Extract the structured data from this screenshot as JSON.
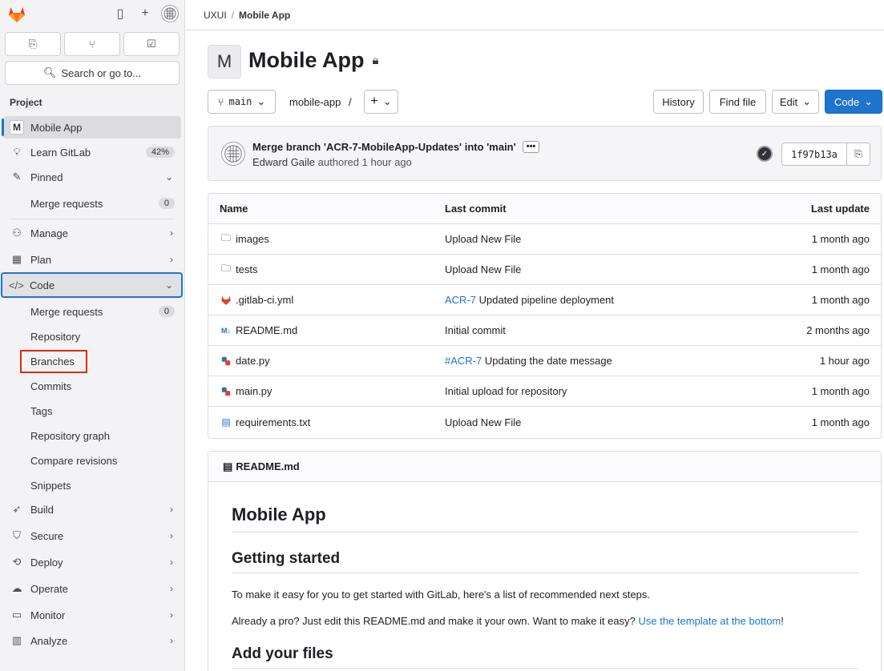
{
  "sidebar": {
    "search_label": "Search or go to...",
    "section_heading": "Project",
    "project_name": "Mobile App",
    "project_initial": "M",
    "learn_gitlab": {
      "label": "Learn GitLab",
      "badge": "42%"
    },
    "pinned": {
      "label": "Pinned"
    },
    "pinned_merge_requests": {
      "label": "Merge requests",
      "badge": "0"
    },
    "manage": "Manage",
    "plan": "Plan",
    "code": "Code",
    "code_items": {
      "merge_requests": {
        "label": "Merge requests",
        "badge": "0"
      },
      "repository": "Repository",
      "branches": "Branches",
      "commits": "Commits",
      "tags": "Tags",
      "repository_graph": "Repository graph",
      "compare_revisions": "Compare revisions",
      "snippets": "Snippets"
    },
    "build": "Build",
    "secure": "Secure",
    "deploy": "Deploy",
    "operate": "Operate",
    "monitor": "Monitor",
    "analyze": "Analyze"
  },
  "breadcrumb": {
    "group": "UXUI",
    "separator": "/",
    "project": "Mobile App"
  },
  "project": {
    "initial": "M",
    "title": "Mobile App"
  },
  "controls": {
    "branch": "main",
    "path": "mobile-app",
    "path_sep": "/",
    "add": "+",
    "history": "History",
    "find_file": "Find file",
    "edit": "Edit",
    "code": "Code"
  },
  "last_commit": {
    "title": "Merge branch 'ACR-7-MobileApp-Updates' into 'main'",
    "author": "Edward Gaile",
    "action": "authored",
    "time": "1 hour ago",
    "sha": "1f97b13a"
  },
  "file_table": {
    "headers": {
      "name": "Name",
      "last_commit": "Last commit",
      "last_update": "Last update"
    },
    "rows": [
      {
        "name": "images",
        "icon": "folder-icon",
        "commit_link": "",
        "commit": "Upload New File",
        "date": "1 month ago"
      },
      {
        "name": "tests",
        "icon": "folder-icon",
        "commit_link": "",
        "commit": "Upload New File",
        "date": "1 month ago"
      },
      {
        "name": ".gitlab-ci.yml",
        "icon": "gitlab-icon",
        "commit_link": "ACR-7",
        "commit": " Updated pipeline deployment",
        "date": "1 month ago"
      },
      {
        "name": "README.md",
        "icon": "markdown-icon",
        "commit_link": "",
        "commit": "Initial commit",
        "date": "2 months ago"
      },
      {
        "name": "date.py",
        "icon": "python-icon",
        "commit_link": "#ACR-7",
        "commit": " Updating the date message",
        "date": "1 hour ago"
      },
      {
        "name": "main.py",
        "icon": "python-icon",
        "commit_link": "",
        "commit": "Initial upload for repository",
        "date": "1 month ago"
      },
      {
        "name": "requirements.txt",
        "icon": "text-file-icon",
        "commit_link": "",
        "commit": "Upload New File",
        "date": "1 month ago"
      }
    ]
  },
  "readme": {
    "file_name": "README.md",
    "h1": "Mobile App",
    "h2_getting_started": "Getting started",
    "p1": "To make it easy for you to get started with GitLab, here's a list of recommended next steps.",
    "p2_text": "Already a pro? Just edit this README.md and make it your own. Want to make it easy?",
    "p2_link": "Use the template at the bottom",
    "p2_end": "!",
    "h2_add_files": "Add your files"
  },
  "colors": {
    "accent": "#1f75cb",
    "highlight_box": "#dd2b0e",
    "gitlab_orange": "#e24329"
  }
}
